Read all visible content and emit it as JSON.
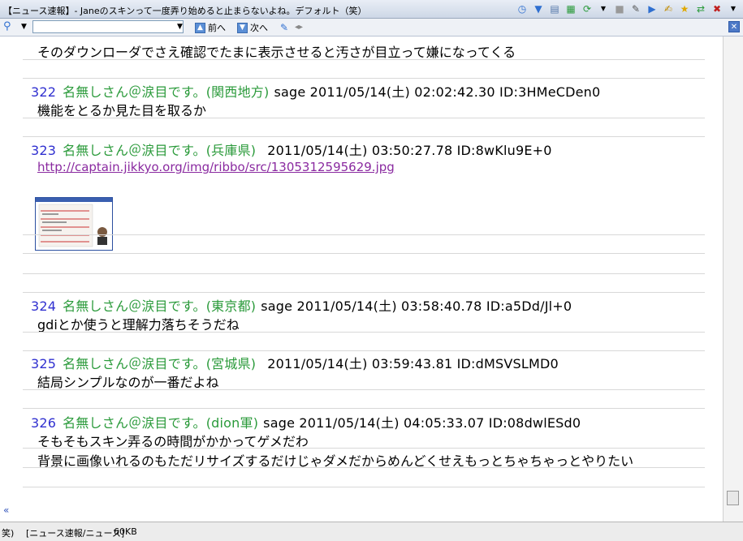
{
  "window": {
    "title": "【ニュース速報】- Janeのスキンって一度弄り始めると止まらないよね。デフォルト（笑）"
  },
  "search": {
    "value": "",
    "prev_label": "前へ",
    "next_label": "次へ"
  },
  "posts": [
    {
      "body": [
        "そのダウンローダでさえ確認でたまに表示させると汚さが目立って嫌になってくる"
      ]
    },
    {
      "num": "322",
      "name": "名無しさん＠涙目です。(関西地方)",
      "meta": "sage 2011/05/14(土) 02:02:42.30 ID:3HMeCDen0",
      "body": [
        "機能をとるか見た目を取るか"
      ]
    },
    {
      "num": "323",
      "name": "名無しさん＠涙目です。(兵庫県)",
      "meta": "2011/05/14(土) 03:50:27.78 ID:8wKlu9E+0",
      "link": "http://captain.jikkyo.org/img/ribbo/src/1305312595629.jpg"
    },
    {
      "num": "324",
      "name": "名無しさん＠涙目です。(東京都)",
      "meta": "sage 2011/05/14(土) 03:58:40.78 ID:a5Dd/Jl+0",
      "body": [
        "gdiとか使うと理解力落ちそうだね"
      ]
    },
    {
      "num": "325",
      "name": "名無しさん＠涙目です。(宮城県)",
      "meta": "2011/05/14(土) 03:59:43.81 ID:dMSVSLMD0",
      "body": [
        "結局シンプルなのが一番だよね"
      ]
    },
    {
      "num": "326",
      "name": "名無しさん＠涙目です。(dion軍)",
      "meta": "sage 2011/05/14(土) 04:05:33.07 ID:08dwlESd0",
      "body": [
        "そもそもスキン弄るの時間がかかってゲメだわ",
        "背景に画像いれるのもただリサイズするだけじゃダメだからめんどくせえもっとちゃちゃっとやりたい"
      ]
    }
  ],
  "nav": {
    "back_symbol": "«"
  },
  "status": {
    "left": "笑)",
    "board": "[ニュース速報/ニュース]",
    "size": "60KB"
  },
  "colors": {
    "post_num": "#3030d0",
    "name": "#2a9a3a",
    "link": "#8a2aa0",
    "separator": "#d8d8d8"
  }
}
